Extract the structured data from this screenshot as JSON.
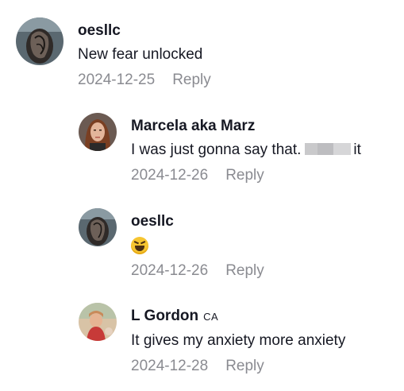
{
  "comments": [
    {
      "username": "oesllc",
      "region": "",
      "text": "New fear unlocked",
      "date": "2024-12-25",
      "reply_label": "Reply"
    },
    {
      "username": "Marcela aka Marz",
      "region": "",
      "text_before": "I was just gonna say that.",
      "text_after": "it",
      "date": "2024-12-26",
      "reply_label": "Reply"
    },
    {
      "username": "oesllc",
      "region": "",
      "text": "😆",
      "date": "2024-12-26",
      "reply_label": "Reply"
    },
    {
      "username": "L Gordon",
      "region": "CA",
      "text": "It gives my anxiety more anxiety",
      "date": "2024-12-28",
      "reply_label": "Reply"
    }
  ],
  "colors": {
    "text": "#161823",
    "secondary": "#8a8b91",
    "emoji": "#f6c531"
  },
  "icons": [
    "avatar-photo",
    "grinning-squinting-face-emoji"
  ]
}
